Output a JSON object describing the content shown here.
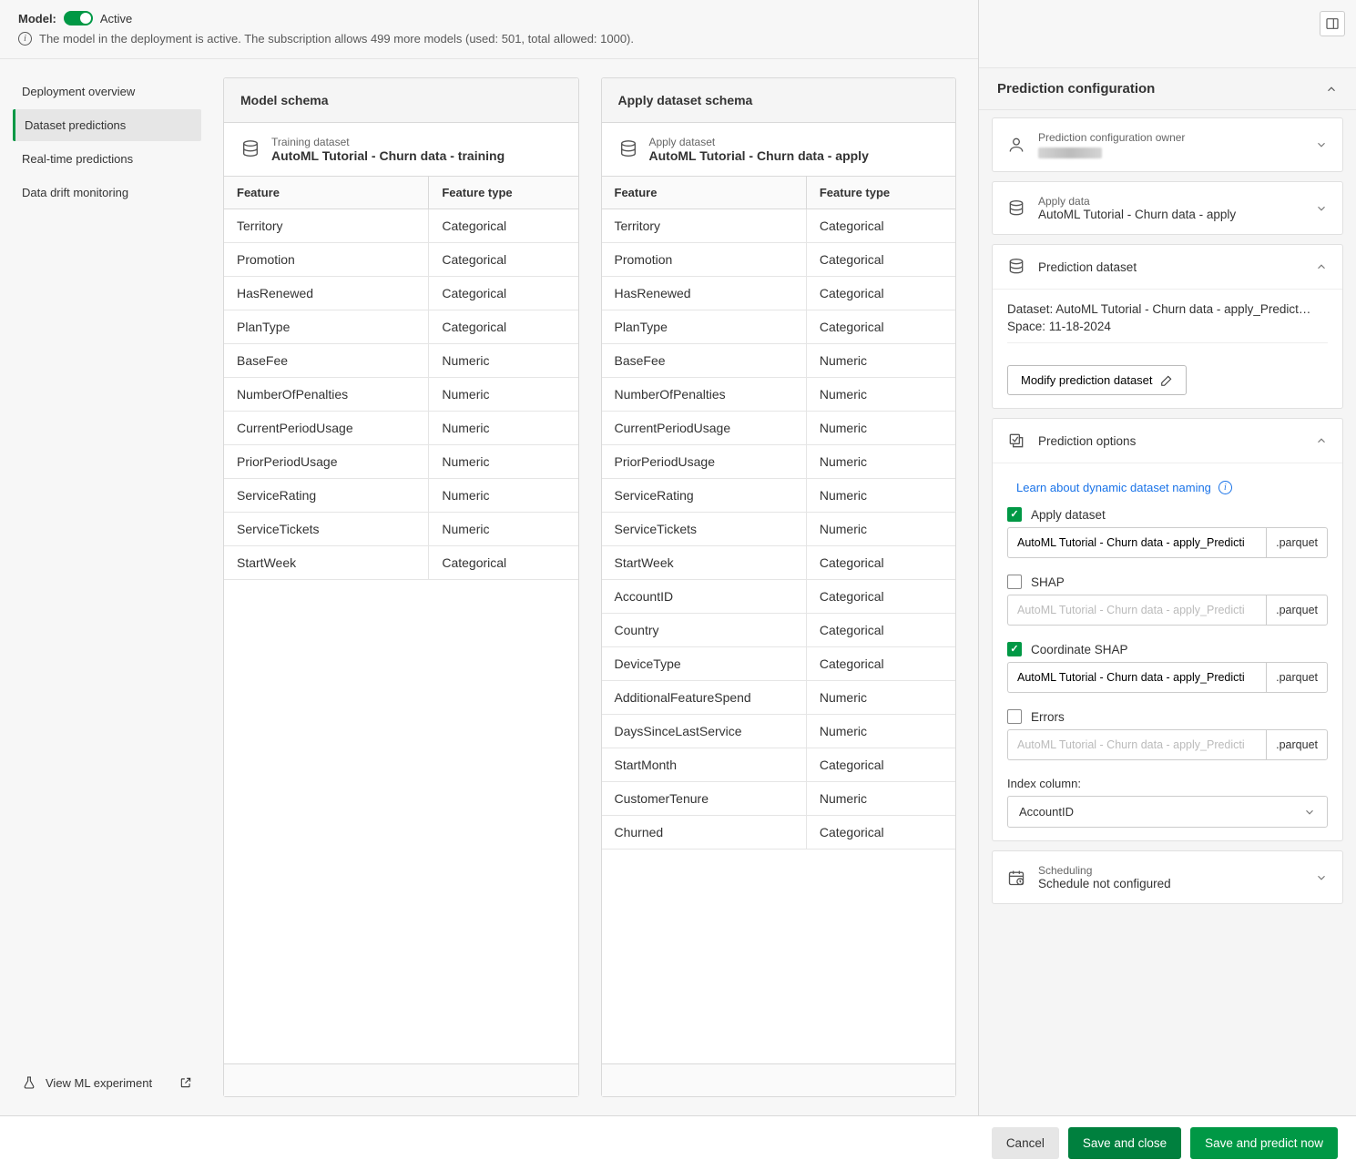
{
  "header": {
    "model_label": "Model:",
    "active_label": "Active",
    "info_text": "The model in the deployment is active. The subscription allows 499 more models (used: 501, total allowed: 1000)."
  },
  "sidebar": {
    "items": [
      {
        "label": "Deployment overview"
      },
      {
        "label": "Dataset predictions"
      },
      {
        "label": "Real-time predictions"
      },
      {
        "label": "Data drift monitoring"
      }
    ],
    "view_experiment": "View ML experiment"
  },
  "model_schema": {
    "title": "Model schema",
    "ds_small": "Training dataset",
    "ds_name": "AutoML Tutorial - Churn data - training",
    "col_feature": "Feature",
    "col_type": "Feature type",
    "rows": [
      {
        "f": "Territory",
        "t": "Categorical"
      },
      {
        "f": "Promotion",
        "t": "Categorical"
      },
      {
        "f": "HasRenewed",
        "t": "Categorical"
      },
      {
        "f": "PlanType",
        "t": "Categorical"
      },
      {
        "f": "BaseFee",
        "t": "Numeric"
      },
      {
        "f": "NumberOfPenalties",
        "t": "Numeric"
      },
      {
        "f": "CurrentPeriodUsage",
        "t": "Numeric"
      },
      {
        "f": "PriorPeriodUsage",
        "t": "Numeric"
      },
      {
        "f": "ServiceRating",
        "t": "Numeric"
      },
      {
        "f": "ServiceTickets",
        "t": "Numeric"
      },
      {
        "f": "StartWeek",
        "t": "Categorical"
      }
    ]
  },
  "apply_schema": {
    "title": "Apply dataset schema",
    "ds_small": "Apply dataset",
    "ds_name": "AutoML Tutorial - Churn data - apply",
    "col_feature": "Feature",
    "col_type": "Feature type",
    "rows": [
      {
        "f": "Territory",
        "t": "Categorical"
      },
      {
        "f": "Promotion",
        "t": "Categorical"
      },
      {
        "f": "HasRenewed",
        "t": "Categorical"
      },
      {
        "f": "PlanType",
        "t": "Categorical"
      },
      {
        "f": "BaseFee",
        "t": "Numeric"
      },
      {
        "f": "NumberOfPenalties",
        "t": "Numeric"
      },
      {
        "f": "CurrentPeriodUsage",
        "t": "Numeric"
      },
      {
        "f": "PriorPeriodUsage",
        "t": "Numeric"
      },
      {
        "f": "ServiceRating",
        "t": "Numeric"
      },
      {
        "f": "ServiceTickets",
        "t": "Numeric"
      },
      {
        "f": "StartWeek",
        "t": "Categorical"
      },
      {
        "f": "AccountID",
        "t": "Categorical"
      },
      {
        "f": "Country",
        "t": "Categorical"
      },
      {
        "f": "DeviceType",
        "t": "Categorical"
      },
      {
        "f": "AdditionalFeatureSpend",
        "t": "Numeric"
      },
      {
        "f": "DaysSinceLastService",
        "t": "Numeric"
      },
      {
        "f": "StartMonth",
        "t": "Categorical"
      },
      {
        "f": "CustomerTenure",
        "t": "Numeric"
      },
      {
        "f": "Churned",
        "t": "Categorical"
      }
    ]
  },
  "right": {
    "title": "Prediction configuration",
    "owner_small": "Prediction configuration owner",
    "apply_small": "Apply data",
    "apply_name": "AutoML Tutorial - Churn data - apply",
    "pred_ds_title": "Prediction dataset",
    "pred_ds_dataset": "Dataset: AutoML Tutorial - Churn data - apply_Predict…",
    "pred_ds_space": "Space: 11-18-2024",
    "modify_btn": "Modify prediction dataset",
    "pred_opts_title": "Prediction options",
    "learn_link": "Learn about dynamic dataset naming",
    "opts": {
      "apply": {
        "label": "Apply dataset",
        "checked": true,
        "fn": "AutoML Tutorial - Churn data - apply_Predicti",
        "ext": ".parquet"
      },
      "shap": {
        "label": "SHAP",
        "checked": false,
        "fn": "AutoML Tutorial - Churn data - apply_Predicti",
        "ext": ".parquet"
      },
      "cshap": {
        "label": "Coordinate SHAP",
        "checked": true,
        "fn": "AutoML Tutorial - Churn data - apply_Predicti",
        "ext": ".parquet"
      },
      "err": {
        "label": "Errors",
        "checked": false,
        "fn": "AutoML Tutorial - Churn data - apply_Predicti",
        "ext": ".parquet"
      }
    },
    "index_label": "Index column:",
    "index_value": "AccountID",
    "sched_small": "Scheduling",
    "sched_big": "Schedule not configured"
  },
  "footer": {
    "cancel": "Cancel",
    "save_close": "Save and close",
    "save_predict": "Save and predict now"
  }
}
